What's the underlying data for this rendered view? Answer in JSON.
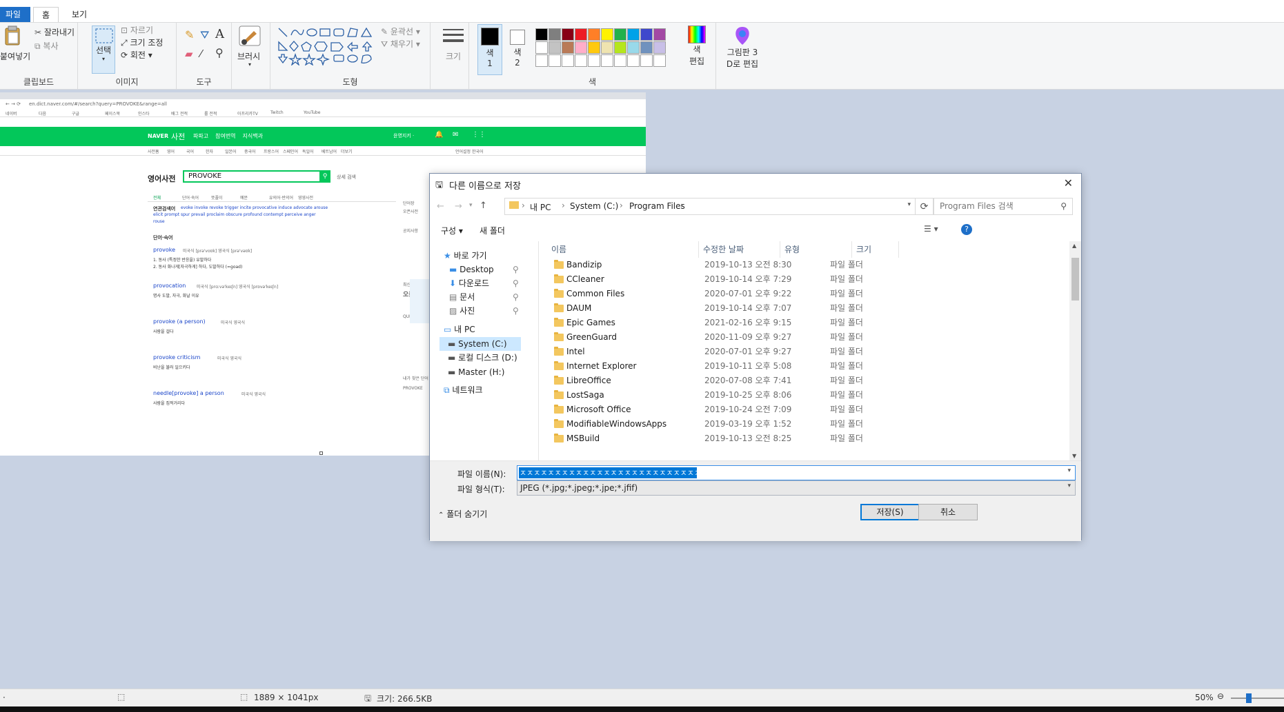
{
  "ribbon_tabs": {
    "file": "파일",
    "home": "홈",
    "view": "보기"
  },
  "clipboard": {
    "paste": "붙여넣기",
    "cut": "잘라내기",
    "copy": "복사",
    "group": "클립보드"
  },
  "image": {
    "select": "선택",
    "crop": "자르기",
    "resize": "크기 조정",
    "rotate": "회전",
    "group": "이미지"
  },
  "tools": {
    "group": "도구"
  },
  "brushes": {
    "label": "브러시"
  },
  "shapes": {
    "outline": "윤곽선",
    "fill": "채우기",
    "group": "도형"
  },
  "size": {
    "label": "크기"
  },
  "colors": {
    "color1": "색\n1",
    "color1_a": "색",
    "color1_b": "1",
    "color2_a": "색",
    "color2_b": "2",
    "edit_a": "색",
    "edit_b": "편집",
    "group": "색",
    "row1": [
      "#000000",
      "#7f7f7f",
      "#880015",
      "#ed1c24",
      "#ff7f27",
      "#fff200",
      "#22b14c",
      "#00a2e8",
      "#3f48cc",
      "#a349a4"
    ],
    "row2": [
      "#ffffff",
      "#c3c3c3",
      "#b97a57",
      "#ffaec9",
      "#ffc90e",
      "#efe4b0",
      "#b5e61d",
      "#99d9ea",
      "#7092be",
      "#c8bfe7"
    ]
  },
  "paint3d": {
    "line1": "그림판 3",
    "line2": "D로 편집"
  },
  "browser": {
    "url": "en.dict.naver.com/#/search?query=PROVOKE&range=all",
    "bookmarks": [
      "네이버",
      "다음",
      "구글",
      "페이스북",
      "인스타",
      "배그 전적",
      "롤 전적",
      "아프리카TV",
      "Twitch",
      "YouTube"
    ],
    "brand": "NAVER",
    "dict": "사전",
    "nav": [
      "파파고",
      "참여번역",
      "지식백과"
    ],
    "user": "윤영지키 ·",
    "subnav": [
      "사전홈",
      "영어",
      "국어",
      "한자",
      "일본어",
      "중국어",
      "프랑스어",
      "스페인어",
      "독일어",
      "베트남어",
      "더보기"
    ],
    "lang_label": "언어설정 한국어",
    "section_title": "영어사전",
    "query": "PROVOKE",
    "detail_search": "상세 검색",
    "result_tabs": [
      "전체",
      "단어·숙어",
      "뜻풀이",
      "예문",
      "유의어·반의어",
      "영영사전"
    ],
    "related_label": "연관검색어",
    "related_words_1": "evoke  invoke  revoke  trigger  incite  provocative  induce  advocate  arouse",
    "related_words_2": "elicit  prompt  spur  prevail  proclaim  obscure  profound  contempt  perceive  anger",
    "related_words_3": "rouse",
    "entries_header": "단어·숙어",
    "entries": [
      {
        "word": "provoke",
        "pron": "미국식 [prə'voʊk]  영국식 [prə'vəʊk]",
        "def": "1. 동사 (특정한 반응을) 유발하다",
        "def2": "2. 동사 화나게[자극하게] 하다, 도발하다 (=goad)"
      },
      {
        "word": "provocation",
        "pron": "미국식 [prɑːvə'keɪʃn]  영국식 [prɒvə'keɪʃn]",
        "def": "명사 도발, 자극, 화날 이유",
        "def2": ""
      },
      {
        "word": "provoke (a person)",
        "pron": "미국식  영국식",
        "def": "사람을 걸다",
        "def2": ""
      },
      {
        "word": "provoke criticism",
        "pron": "미국식  영국식",
        "def": "비난을 불러 일으키다",
        "def2": ""
      },
      {
        "word": "needle[provoke] a person",
        "pron": "미국식  영국식",
        "def": "사람을 집적거리다",
        "def2": ""
      }
    ],
    "side_items": [
      "단어장",
      "오픈사전",
      "공지사항",
      "최신 이슈",
      "오늘의",
      "QUIZ",
      "내가 찾은 단어",
      "PROVOKE"
    ]
  },
  "dialog": {
    "title": "다른 이름으로 저장",
    "path": [
      "내 PC",
      "System (C:)",
      "Program Files"
    ],
    "search_placeholder": "Program Files 검색",
    "organize": "구성 ▾",
    "new_folder": "새 폴더",
    "columns": {
      "name": "이름",
      "date": "수정한 날짜",
      "type": "유형",
      "size": "크기"
    },
    "nav": {
      "quick": "바로 가기",
      "desktop": "Desktop",
      "downloads": "다운로드",
      "documents": "문서",
      "pictures": "사진",
      "thispc": "내 PC",
      "c": "System (C:)",
      "d": "로컬 디스크 (D:)",
      "h": "Master (H:)",
      "network": "네트워크"
    },
    "files": [
      {
        "name": "Bandizip",
        "date": "2019-10-13 오전 8:30",
        "type": "파일 폴더"
      },
      {
        "name": "CCleaner",
        "date": "2019-10-14 오후 7:29",
        "type": "파일 폴더"
      },
      {
        "name": "Common Files",
        "date": "2020-07-01 오후 9:22",
        "type": "파일 폴더"
      },
      {
        "name": "DAUM",
        "date": "2019-10-14 오후 7:07",
        "type": "파일 폴더"
      },
      {
        "name": "Epic Games",
        "date": "2021-02-16 오후 9:15",
        "type": "파일 폴더"
      },
      {
        "name": "GreenGuard",
        "date": "2020-11-09 오후 9:27",
        "type": "파일 폴더"
      },
      {
        "name": "Intel",
        "date": "2020-07-01 오후 9:27",
        "type": "파일 폴더"
      },
      {
        "name": "Internet Explorer",
        "date": "2019-10-11 오후 5:08",
        "type": "파일 폴더"
      },
      {
        "name": "LibreOffice",
        "date": "2020-07-08 오후 7:41",
        "type": "파일 폴더"
      },
      {
        "name": "LostSaga",
        "date": "2019-10-25 오후 8:06",
        "type": "파일 폴더"
      },
      {
        "name": "Microsoft Office",
        "date": "2019-10-24 오전 7:09",
        "type": "파일 폴더"
      },
      {
        "name": "ModifiableWindowsApps",
        "date": "2019-03-19 오후 1:52",
        "type": "파일 폴더"
      },
      {
        "name": "MSBuild",
        "date": "2019-10-13 오전 8:25",
        "type": "파일 폴더"
      }
    ],
    "filename_label": "파일 이름(N):",
    "filename_value": "ㅈㅈㅈㅈㅈㅈㅈㅈㅈㅈㅈㅈㅈㅈㅈㅈㅈㅈㅈㅈㅈㅈㅈㅈㅈㅈㅈ",
    "filetype_label": "파일 형식(T):",
    "filetype_value": "JPEG (*.jpg;*.jpeg;*.jpe;*.jfif)",
    "hide_folders": "폴더 숨기기",
    "save": "저장(S)",
    "cancel": "취소"
  },
  "status": {
    "dimensions": "1889 × 1041px",
    "size": "크기: 266.5KB",
    "zoom": "50%"
  }
}
